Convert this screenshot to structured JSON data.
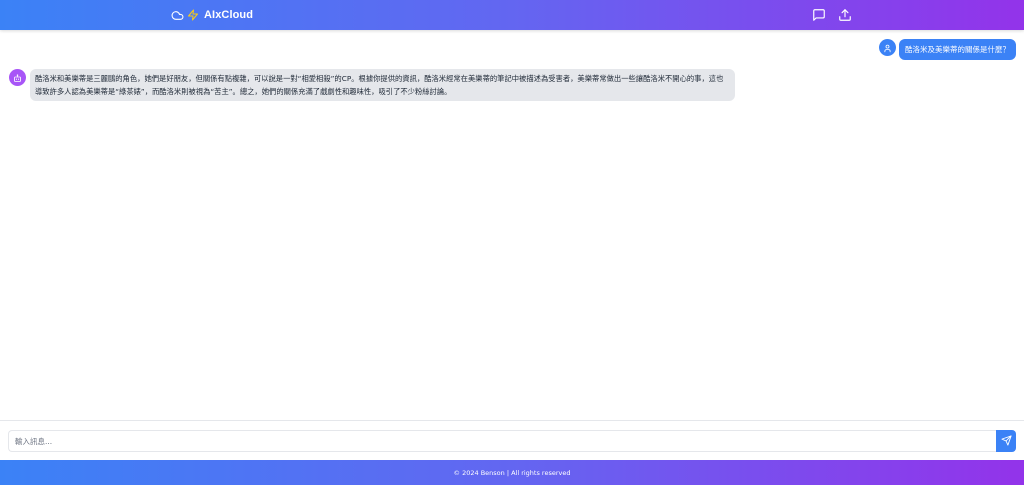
{
  "header": {
    "brand_title": "AIxCloud",
    "icons": [
      "cloud-icon",
      "zap-icon",
      "message-square-icon",
      "upload-icon"
    ]
  },
  "chat": {
    "messages": [
      {
        "role": "user",
        "avatar_icon": "user-icon",
        "text": "酷洛米及美樂蒂的關係是什麼？"
      },
      {
        "role": "assistant",
        "avatar_icon": "bot-icon",
        "text": "酷洛米和美樂蒂是三麗鷗的角色，她們是好朋友，但關係有點複雜，可以說是一對“相愛相殺”的CP。根據你提供的資訊，酷洛米經常在美樂蒂的筆記中被描述為受害者，美樂蒂常做出一些讓酷洛米不開心的事，這也導致許多人認為美樂蒂是“綠茶婊”，而酷洛米則被視為“苦主”。總之，她們的關係充滿了戲劇性和趣味性，吸引了不少粉絲討論。"
      }
    ]
  },
  "composer": {
    "placeholder": "輸入訊息...",
    "send_icon": "send-icon"
  },
  "footer": {
    "text": "© 2024 Benson | All rights reserved"
  },
  "colors": {
    "gradient_start": "#3b82f6",
    "gradient_mid": "#6366f1",
    "gradient_end": "#9333ea",
    "user_bubble": "#3b82f6",
    "bot_bubble": "#e5e7eb",
    "bot_avatar": "#a855f7"
  }
}
